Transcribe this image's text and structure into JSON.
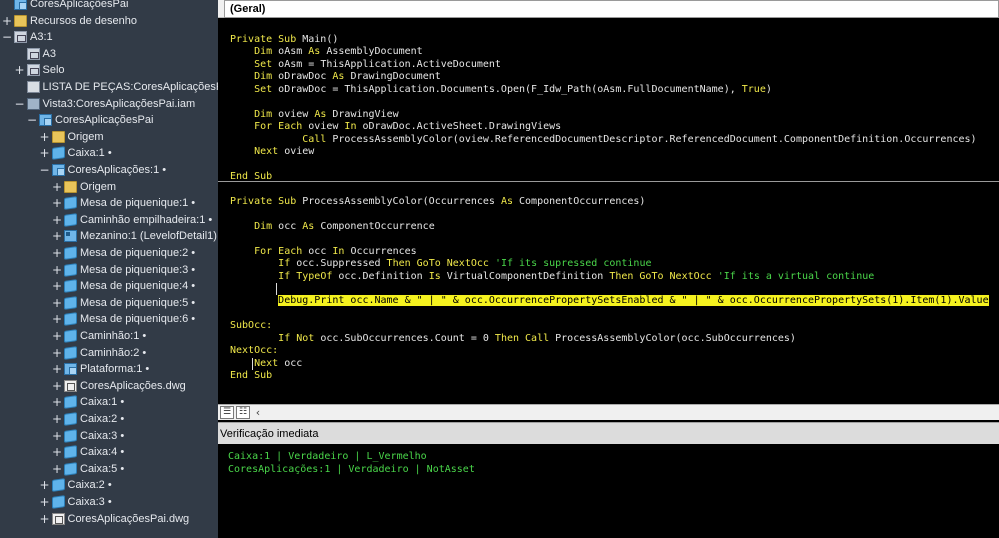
{
  "tree": {
    "items": [
      {
        "label": "CoresAplicaçõesPai",
        "icon": "assembly-icon",
        "exp": ""
      },
      {
        "label": "Recursos de desenho",
        "icon": "folder-icon",
        "exp": "+"
      },
      {
        "label": "A3:1",
        "icon": "sheet-icon",
        "exp": "−"
      },
      {
        "label": "A3",
        "icon": "sheet-icon",
        "exp": ""
      },
      {
        "label": "Selo",
        "icon": "title-block-icon",
        "exp": "+"
      },
      {
        "label": "LISTA DE PEÇAS:CoresAplicaçõesPai.iam",
        "icon": "parts-list-icon",
        "exp": ""
      },
      {
        "label": "Vista3:CoresAplicaçõesPai.iam",
        "icon": "drawing-view-icon",
        "exp": "−"
      },
      {
        "label": "CoresAplicaçõesPai",
        "icon": "assembly-icon",
        "exp": "−"
      },
      {
        "label": "Origem",
        "icon": "folder-icon",
        "exp": "+"
      },
      {
        "label": "Caixa:1 •",
        "icon": "part-icon",
        "exp": "+"
      },
      {
        "label": "CoresAplicações:1 •",
        "icon": "assembly-icon",
        "exp": "−"
      },
      {
        "label": "Origem",
        "icon": "folder-icon",
        "exp": "+"
      },
      {
        "label": "Mesa de piquenique:1 •",
        "icon": "part-icon",
        "exp": "+"
      },
      {
        "label": "Caminhão empilhadeira:1 •",
        "icon": "part-icon",
        "exp": "+"
      },
      {
        "label": "Mezanino:1 (LevelofDetail1) •",
        "icon": "multi-body-icon",
        "exp": "+"
      },
      {
        "label": "Mesa de piquenique:2 •",
        "icon": "part-icon",
        "exp": "+"
      },
      {
        "label": "Mesa de piquenique:3 •",
        "icon": "part-icon",
        "exp": "+"
      },
      {
        "label": "Mesa de piquenique:4 •",
        "icon": "part-icon",
        "exp": "+"
      },
      {
        "label": "Mesa de piquenique:5 •",
        "icon": "part-icon",
        "exp": "+"
      },
      {
        "label": "Mesa de piquenique:6 •",
        "icon": "part-icon",
        "exp": "+"
      },
      {
        "label": "Caminhão:1 •",
        "icon": "part-icon",
        "exp": "+"
      },
      {
        "label": "Caminhão:2 •",
        "icon": "part-icon",
        "exp": "+"
      },
      {
        "label": "Plataforma:1 •",
        "icon": "assembly-icon",
        "exp": "+"
      },
      {
        "label": "CoresAplicações.dwg",
        "icon": "drawing-file-icon",
        "exp": "+"
      },
      {
        "label": "Caixa:1 •",
        "icon": "part-icon",
        "exp": "+"
      },
      {
        "label": "Caixa:2 •",
        "icon": "part-icon",
        "exp": "+"
      },
      {
        "label": "Caixa:3 •",
        "icon": "part-icon",
        "exp": "+"
      },
      {
        "label": "Caixa:4 •",
        "icon": "part-icon",
        "exp": "+"
      },
      {
        "label": "Caixa:5 •",
        "icon": "part-icon",
        "exp": "+"
      },
      {
        "label": "Caixa:2 •",
        "icon": "part-icon",
        "exp": "+"
      },
      {
        "label": "Caixa:3 •",
        "icon": "part-icon",
        "exp": "+"
      },
      {
        "label": "CoresAplicaçõesPai.dwg",
        "icon": "drawing-file-icon",
        "exp": "+"
      }
    ]
  },
  "editor": {
    "object_dropdown": "(Geral)",
    "code_lines": [
      [
        [
          "kw",
          "Private Sub "
        ],
        [
          "",
          "Main()"
        ]
      ],
      [
        [
          "",
          "    "
        ],
        [
          "kw",
          "Dim"
        ],
        [
          "",
          " oAsm "
        ],
        [
          "kw",
          "As"
        ],
        [
          "",
          " AssemblyDocument"
        ]
      ],
      [
        [
          "",
          "    "
        ],
        [
          "kw",
          "Set"
        ],
        [
          "",
          " oAsm = ThisApplication.ActiveDocument"
        ]
      ],
      [
        [
          "",
          "    "
        ],
        [
          "kw",
          "Dim"
        ],
        [
          "",
          " oDrawDoc "
        ],
        [
          "kw",
          "As"
        ],
        [
          "",
          " DrawingDocument"
        ]
      ],
      [
        [
          "",
          "    "
        ],
        [
          "kw",
          "Set"
        ],
        [
          "",
          " oDrawDoc = ThisApplication.Documents.Open(F_Idw_Path(oAsm.FullDocumentName), "
        ],
        [
          "kw",
          "True"
        ],
        [
          "",
          ")"
        ]
      ],
      [],
      [
        [
          "",
          "    "
        ],
        [
          "kw",
          "Dim"
        ],
        [
          "",
          " oview "
        ],
        [
          "kw",
          "As"
        ],
        [
          "",
          " DrawingView"
        ]
      ],
      [
        [
          "",
          "    "
        ],
        [
          "kw",
          "For Each"
        ],
        [
          "",
          " oview "
        ],
        [
          "kw",
          "In"
        ],
        [
          "",
          " oDrawDoc.ActiveSheet.DrawingViews"
        ]
      ],
      [
        [
          "",
          "            "
        ],
        [
          "kw",
          "Call"
        ],
        [
          "",
          " ProcessAssemblyColor(oview.ReferencedDocumentDescriptor.ReferencedDocument.ComponentDefinition.Occurrences)"
        ]
      ],
      [
        [
          "",
          "    "
        ],
        [
          "kw",
          "Next"
        ],
        [
          "",
          " oview"
        ]
      ],
      [],
      [
        [
          "kw",
          "End Sub"
        ]
      ],
      [],
      [
        [
          "kw",
          "Private Sub "
        ],
        [
          "",
          "ProcessAssemblyColor(Occurrences "
        ],
        [
          "kw",
          "As"
        ],
        [
          "",
          " ComponentOccurrences)"
        ]
      ],
      [],
      [
        [
          "",
          "    "
        ],
        [
          "kw",
          "Dim"
        ],
        [
          "",
          " occ "
        ],
        [
          "kw",
          "As"
        ],
        [
          "",
          " ComponentOccurrence"
        ]
      ],
      [],
      [
        [
          "",
          "    "
        ],
        [
          "kw",
          "For Each"
        ],
        [
          "",
          " occ "
        ],
        [
          "kw",
          "In"
        ],
        [
          "",
          " Occurrences"
        ]
      ],
      [
        [
          "",
          "        "
        ],
        [
          "kw",
          "If"
        ],
        [
          "",
          " occ.Suppressed "
        ],
        [
          "kw",
          "Then GoTo"
        ],
        [
          "",
          " "
        ],
        [
          "kw",
          "NextOcc"
        ],
        [
          "",
          " "
        ],
        [
          "cm",
          "'If its supressed continue"
        ]
      ],
      [
        [
          "",
          "        "
        ],
        [
          "kw",
          "If TypeOf"
        ],
        [
          "",
          " occ.Definition "
        ],
        [
          "kw",
          "Is"
        ],
        [
          "",
          " VirtualComponentDefinition "
        ],
        [
          "kw",
          "Then GoTo"
        ],
        [
          "",
          " "
        ],
        [
          "kw",
          "NextOcc"
        ],
        [
          "",
          " "
        ],
        [
          "cm",
          "'If its a virtual continue"
        ]
      ],
      [],
      [
        [
          "",
          "        "
        ],
        [
          "hl",
          "Debug.Print occ.Name & \" | \" & occ.OccurrencePropertySetsEnabled & \" | \" & occ.OccurrencePropertySets(1).Item(1).Value"
        ]
      ],
      [],
      [
        [
          "kw",
          "SubOcc:"
        ]
      ],
      [
        [
          "",
          "        "
        ],
        [
          "kw",
          "If Not"
        ],
        [
          "",
          " occ.SubOccurrences.Count = 0 "
        ],
        [
          "kw",
          "Then Call"
        ],
        [
          "",
          " ProcessAssemblyColor(occ.SubOccurrences)"
        ]
      ],
      [
        [
          "kw",
          "NextOcc:"
        ]
      ],
      [
        [
          "",
          "    "
        ],
        [
          "kw",
          "Next"
        ],
        [
          "",
          " occ"
        ]
      ],
      [
        [
          "kw",
          "End Sub"
        ]
      ]
    ]
  },
  "immediate": {
    "title": "Verificação imediata",
    "lines": [
      "Caixa:1 | Verdadeiro | L_Vermelho",
      "CoresAplicações:1 | Verdadeiro | NotAsset"
    ]
  },
  "colors": {
    "keyword": "#f0e84a",
    "comment": "#4ad64a",
    "highlight": "#f5f21f",
    "tree_bg": "#323b47"
  }
}
